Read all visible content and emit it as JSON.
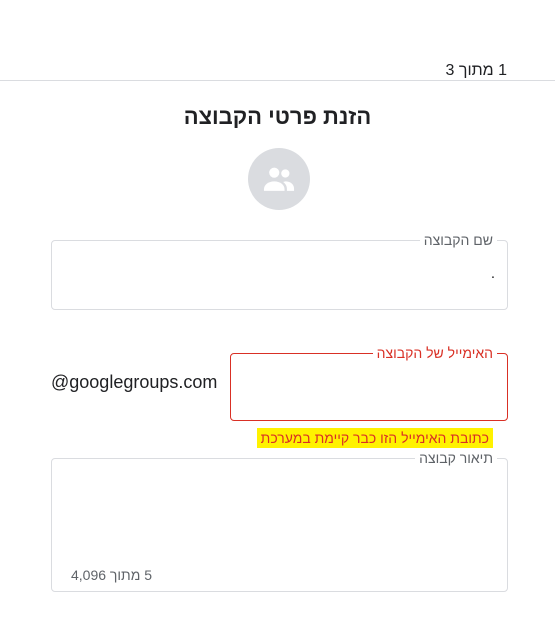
{
  "header": {
    "step_indicator": "1 מתוך 3"
  },
  "form": {
    "title": "הזנת פרטי הקבוצה",
    "avatar_icon": "group-icon",
    "group_name": {
      "label": "שם הקבוצה",
      "value": "."
    },
    "group_email": {
      "label": "האימייל של הקבוצה",
      "value": "",
      "domain_suffix": "@googlegroups.com",
      "error": "כתובת האימייל הזו כבר קיימת במערכת"
    },
    "group_description": {
      "label": "תיאור קבוצה",
      "value": "",
      "counter": "5 מתוך 4,096"
    }
  },
  "colors": {
    "error": "#d93025",
    "border": "#dadce0",
    "highlight": "#fff200",
    "avatar_bg": "#dadce0"
  }
}
